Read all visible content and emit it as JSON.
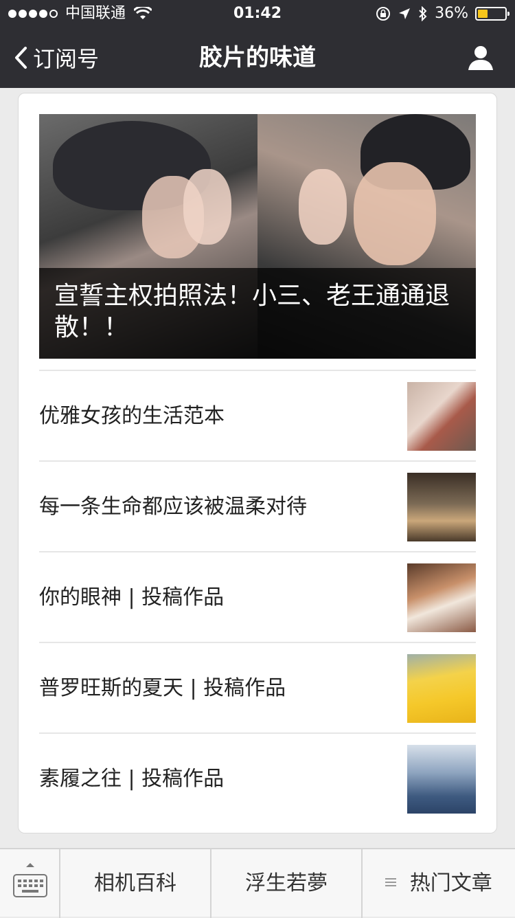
{
  "status_bar": {
    "carrier": "中国联通",
    "time": "01:42",
    "battery_percent_text": "36%",
    "battery_level": 0.36
  },
  "nav": {
    "back_label": "订阅号",
    "title": "胶片的味道"
  },
  "hero": {
    "caption": "宣誓主权拍照法！小三、老王通通退散！！"
  },
  "articles": [
    {
      "title": "优雅女孩的生活范本"
    },
    {
      "title": "每一条生命都应该被温柔对待"
    },
    {
      "title": "你的眼神 | 投稿作品"
    },
    {
      "title": "普罗旺斯的夏天 | 投稿作品"
    },
    {
      "title": "素履之往 | 投稿作品"
    }
  ],
  "tab_bar": {
    "tabs": [
      "相机百科",
      "浮生若夢",
      "热门文章"
    ]
  },
  "colors": {
    "bar_background": "#2e2e33",
    "battery": "#f7c61b"
  }
}
